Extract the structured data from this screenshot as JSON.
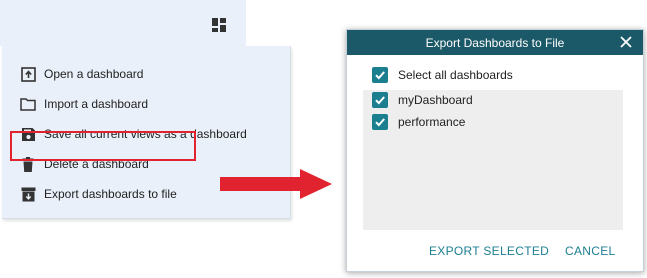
{
  "menu": {
    "items": [
      {
        "label": "Open a dashboard",
        "icon": "open-dashboard-icon"
      },
      {
        "label": "Import a dashboard",
        "icon": "folder-icon"
      },
      {
        "label": "Save all current views as a dashboard",
        "icon": "save-icon"
      },
      {
        "label": "Delete a dashboard",
        "icon": "trash-icon"
      },
      {
        "label": "Export dashboards to file",
        "icon": "export-icon"
      }
    ]
  },
  "dialog": {
    "title": "Export Dashboards to File",
    "select_all_label": "Select all dashboards",
    "select_all_checked": true,
    "dashboards": [
      {
        "label": "myDashboard",
        "checked": true
      },
      {
        "label": "performance",
        "checked": true
      }
    ],
    "export_button": "EXPORT SELECTED",
    "cancel_button": "CANCEL"
  },
  "colors": {
    "menu_background": "#eaf0f9",
    "dialog_header": "#1c5968",
    "checkbox": "#1c7f90",
    "accent_text": "#1c7f90",
    "highlight": "#e0232e",
    "arrow": "#e0232e"
  }
}
